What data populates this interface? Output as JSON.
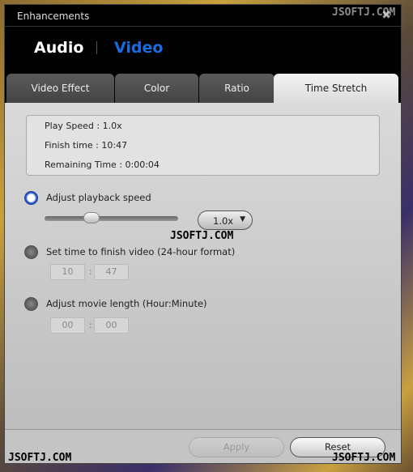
{
  "window": {
    "title": "Enhancements"
  },
  "header": {
    "tabs": [
      {
        "label": "Audio",
        "active": false
      },
      {
        "label": "Video",
        "active": true
      }
    ],
    "active_color": "#1a6be0"
  },
  "tabs": [
    {
      "label": "Video Effect"
    },
    {
      "label": "Color"
    },
    {
      "label": "Ratio"
    },
    {
      "label": "Time Stretch",
      "active": true
    }
  ],
  "info": {
    "play_speed": "Play Speed : 1.0x",
    "finish_time": "Finish time : 10:47",
    "remaining": "Remaining Time : 0:00:04"
  },
  "options": {
    "speed": {
      "label": "Adjust playback speed",
      "selected": true,
      "dropdown": "1.0x"
    },
    "finish": {
      "label": "Set time to finish video (24-hour format)",
      "selected": false,
      "hour": "10",
      "minute": "47"
    },
    "length": {
      "label": "Adjust movie length (Hour:Minute)",
      "selected": false,
      "hour": "00",
      "minute": "00"
    }
  },
  "footer": {
    "apply": "Apply",
    "reset": "Reset"
  },
  "watermark": "JSOFTJ.COM"
}
